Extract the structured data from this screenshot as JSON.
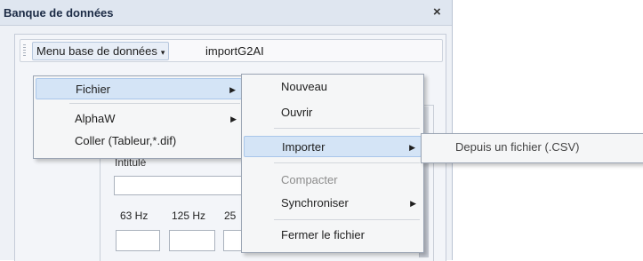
{
  "window": {
    "title": "Banque de données",
    "close_glyph": "×"
  },
  "menubar": {
    "menu_label": "Menu base de données",
    "menu_arrow": "▾",
    "extra_text": "importG2AI"
  },
  "form": {
    "intitule_label": "Intitulé",
    "hz_labels": [
      "63 Hz",
      "125 Hz",
      "25"
    ]
  },
  "menu_main": {
    "items": [
      {
        "label": "Fichier",
        "submenu": "▶",
        "highlighted": true
      },
      {
        "label": "AlphaW",
        "submenu": "▶"
      },
      {
        "label": "Coller (Tableur,*.dif)"
      }
    ]
  },
  "menu_fichier": {
    "items": [
      {
        "label": "Nouveau"
      },
      {
        "label": "Ouvrir"
      },
      {
        "label": "Importer",
        "submenu": "▶",
        "highlighted": true
      },
      {
        "label": "Compacter",
        "disabled": true
      },
      {
        "label": "Synchroniser",
        "submenu": "▶"
      },
      {
        "label": "Fermer le fichier"
      }
    ]
  },
  "menu_importer": {
    "items": [
      {
        "label": "Depuis un fichier (.CSV)"
      }
    ]
  },
  "colors": {
    "highlight": "#d4e4f6",
    "highlight_border": "#a9c6ea",
    "menu_bg": "#f5f6f7"
  }
}
